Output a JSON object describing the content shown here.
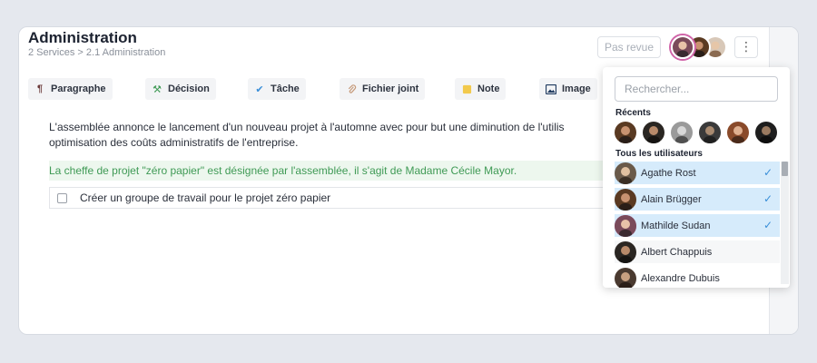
{
  "header": {
    "title": "Administration",
    "breadcrumb": "2 Services > 2.1 Administration",
    "review_label": "Pas revue",
    "more_label": "⋮"
  },
  "toolbar": {
    "items": [
      {
        "label": "Paragraphe",
        "icon": "paragraph-icon",
        "glyph": "¶",
        "color": "#6b3a3a"
      },
      {
        "label": "Décision",
        "icon": "gavel-icon",
        "glyph": "⚒",
        "color": "#3f9a55"
      },
      {
        "label": "Tâche",
        "icon": "check-icon",
        "glyph": "✔",
        "color": "#3a8fd8"
      },
      {
        "label": "Fichier joint",
        "icon": "paperclip-icon",
        "glyph": "⌇",
        "color": "#c69a7a"
      },
      {
        "label": "Note",
        "icon": "sticky-note-icon",
        "glyph": "■",
        "color": "#f2c94c"
      },
      {
        "label": "Image",
        "icon": "image-icon",
        "glyph": "▣",
        "color": "#1f3a5f"
      }
    ]
  },
  "content": {
    "paragraph_line1": "L'assemblée annonce le lancement d'un nouveau projet à l'automne avec pour but une diminution de l'utilis",
    "paragraph_line2": "optimisation des coûts administratifs de l'entreprise.",
    "decision": "La cheffe de projet \"zéro papier\" est désignée par l'assemblée, il s'agit de Madame Cécile Mayor.",
    "task": "Créer un groupe de travail pour le projet zéro papier"
  },
  "user_picker": {
    "search_placeholder": "Rechercher...",
    "recent_label": "Récents",
    "all_label": "Tous les utilisateurs",
    "users": [
      {
        "name": "Agathe Rost",
        "selected": true
      },
      {
        "name": "Alain Brügger",
        "selected": true
      },
      {
        "name": "Mathilde Sudan",
        "selected": true
      },
      {
        "name": "Albert Chappuis",
        "selected": false
      },
      {
        "name": "Alexandre Dubuis",
        "selected": false
      }
    ],
    "check_glyph": "✓"
  },
  "colors": {
    "accent": "#3a8fd8",
    "selected_bg": "#d6ebfb",
    "decision_green": "#3f9a55",
    "avatar_ring": "#d064a8"
  }
}
